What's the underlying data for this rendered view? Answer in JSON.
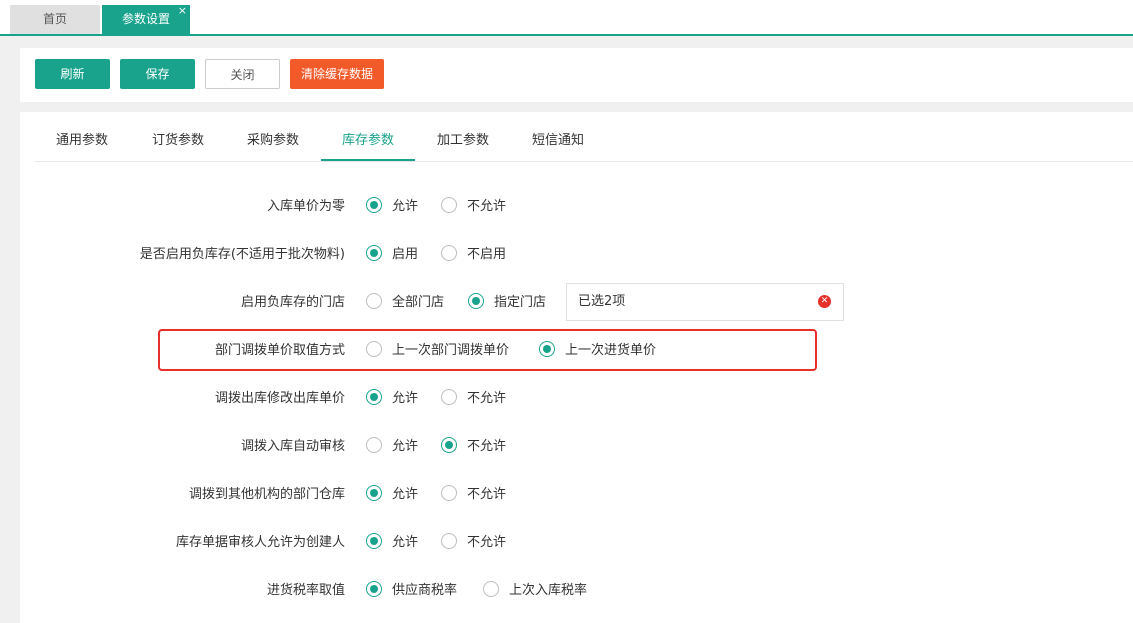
{
  "top_tabs": [
    {
      "label": "首页"
    },
    {
      "label": "参数设置",
      "close": "×"
    }
  ],
  "toolbar": {
    "refresh": "刷新",
    "save": "保存",
    "close": "关闭",
    "clear_cache": "清除缓存数据"
  },
  "sub_tabs": [
    {
      "label": "通用参数"
    },
    {
      "label": "订货参数"
    },
    {
      "label": "采购参数"
    },
    {
      "label": "库存参数"
    },
    {
      "label": "加工参数"
    },
    {
      "label": "短信通知"
    }
  ],
  "active_sub_tab": "库存参数",
  "settings": [
    {
      "label": "入库单价为零",
      "options": [
        "允许",
        "不允许"
      ],
      "selected": 0
    },
    {
      "label": "是否启用负库存(不适用于批次物料)",
      "options": [
        "启用",
        "不启用"
      ],
      "selected": 0
    },
    {
      "label": "启用负库存的门店",
      "options": [
        "全部门店",
        "指定门店"
      ],
      "selected": 1,
      "store_value": "已选2项"
    },
    {
      "label": "部门调拨单价取值方式",
      "options": [
        "上一次部门调拨单价",
        "上一次进货单价"
      ],
      "selected": 1,
      "highlighted": true
    },
    {
      "label": "调拨出库修改出库单价",
      "options": [
        "允许",
        "不允许"
      ],
      "selected": 0
    },
    {
      "label": "调拨入库自动审核",
      "options": [
        "允许",
        "不允许"
      ],
      "selected": 1
    },
    {
      "label": "调拨到其他机构的部门仓库",
      "options": [
        "允许",
        "不允许"
      ],
      "selected": 0
    },
    {
      "label": "库存单据审核人允许为创建人",
      "options": [
        "允许",
        "不允许"
      ],
      "selected": 0
    },
    {
      "label": "进货税率取值",
      "options": [
        "供应商税率",
        "上次入库税率"
      ],
      "selected": 0
    }
  ],
  "colors": {
    "accent": "#1aa38c",
    "danger": "#f25a2a",
    "highlight_border": "#e8302a"
  }
}
